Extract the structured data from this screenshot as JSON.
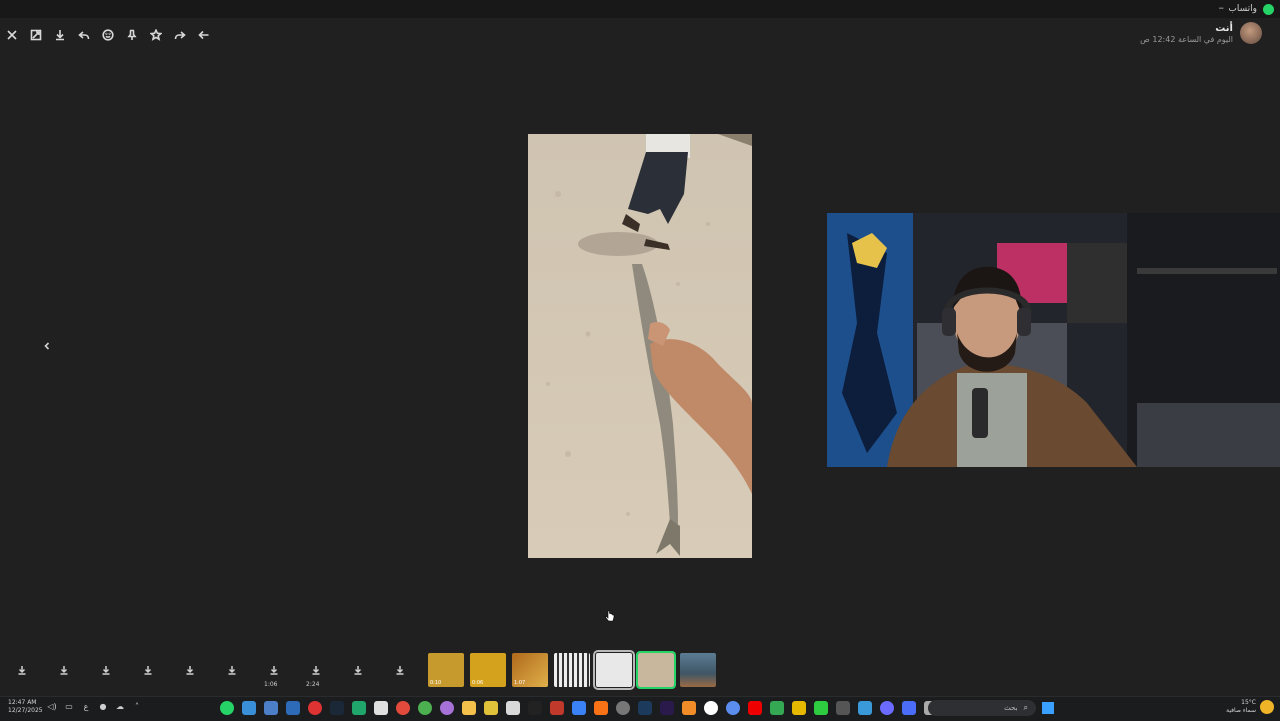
{
  "titlebar": {
    "app_name": "واتساب",
    "minimize": "–"
  },
  "toolbar": {
    "items": [
      {
        "name": "close-icon",
        "icon": "x"
      },
      {
        "name": "expand-icon",
        "icon": "resize"
      },
      {
        "name": "download-icon",
        "icon": "download"
      },
      {
        "name": "reply-icon",
        "icon": "reply"
      },
      {
        "name": "emoji-icon",
        "icon": "smiley"
      },
      {
        "name": "pin-icon",
        "icon": "pin"
      },
      {
        "name": "star-icon",
        "icon": "star"
      },
      {
        "name": "forward-icon",
        "icon": "forward"
      },
      {
        "name": "back-icon",
        "icon": "arrow-left"
      }
    ]
  },
  "sender": {
    "name": "أنت",
    "time": "اليوم في الساعة 12:42 ص"
  },
  "viewer": {
    "prev_icon": "chevron-left"
  },
  "strip": {
    "durations": [
      "1:06",
      "2:24"
    ],
    "thumb_captions": [
      "0:10",
      "0:06",
      "1:07"
    ]
  },
  "taskbar": {
    "time": "12:47 AM",
    "date": "12/27/2025",
    "lang": "ع",
    "search_label": "بحث",
    "weather_temp": "15°C",
    "weather_text": "سماء صافية"
  },
  "colors": {
    "accent": "#25d366",
    "background": "#1f201f"
  }
}
